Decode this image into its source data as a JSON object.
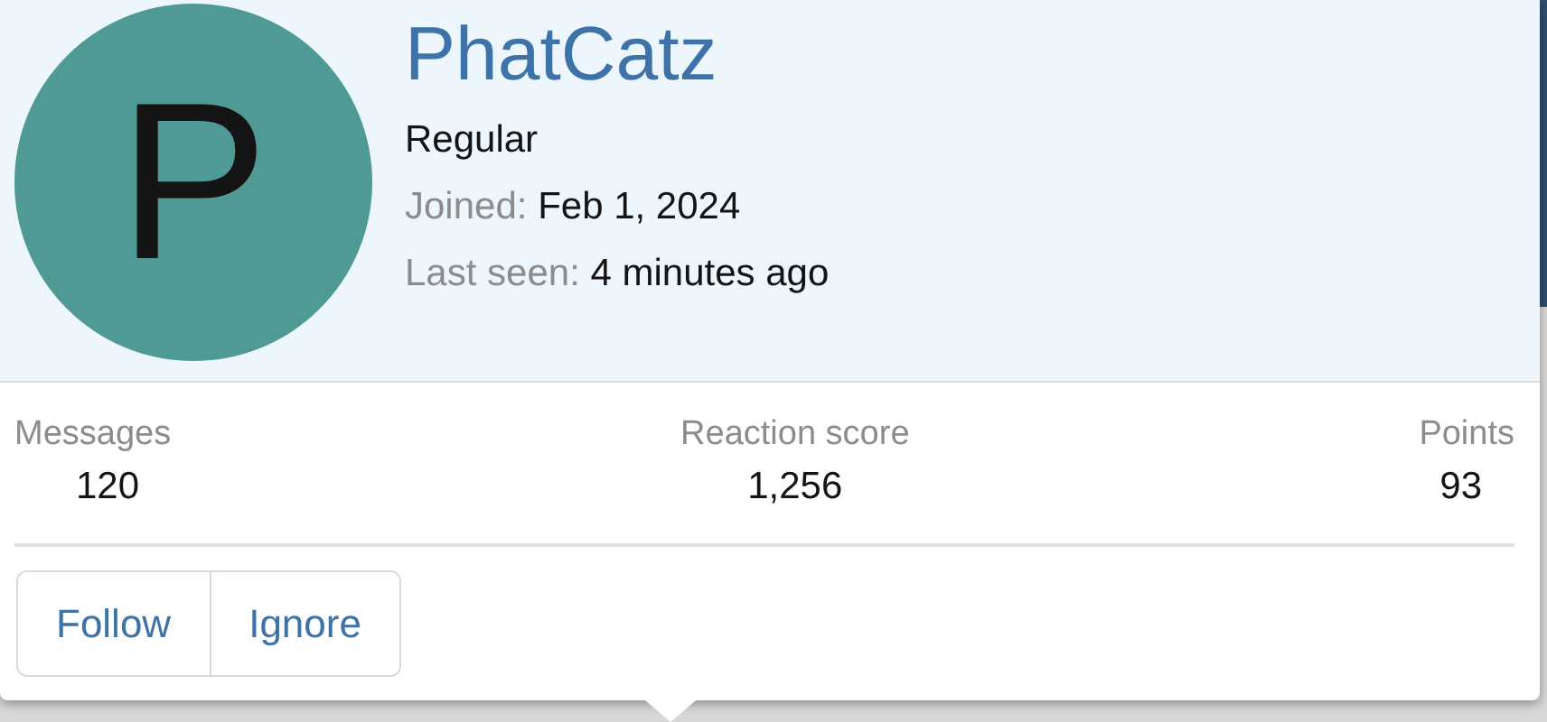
{
  "profile": {
    "avatar_letter": "P",
    "username": "PhatCatz",
    "title": "Regular",
    "details": [
      {
        "label": "Joined:",
        "value": "Feb 1, 2024"
      },
      {
        "label": "Last seen:",
        "value": "4 minutes ago"
      }
    ]
  },
  "stats": [
    {
      "label": "Messages",
      "value": "120"
    },
    {
      "label": "Reaction score",
      "value": "1,256"
    },
    {
      "label": "Points",
      "value": "93"
    }
  ],
  "buttons": [
    "Follow",
    "Ignore"
  ]
}
